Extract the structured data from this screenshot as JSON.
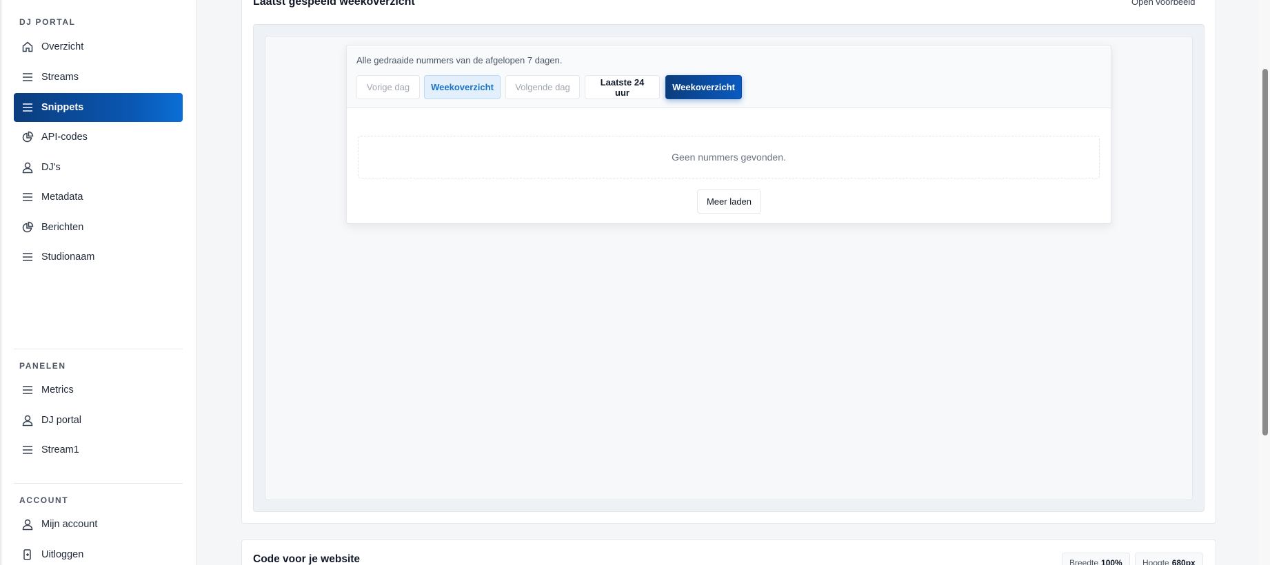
{
  "sidebar": {
    "section_portal": "DJ PORTAL",
    "portal_items": [
      {
        "label": "Overzicht",
        "icon": "home-icon"
      },
      {
        "label": "Streams",
        "icon": "list-icon"
      },
      {
        "label": "Snippets",
        "icon": "list-icon",
        "active": true
      },
      {
        "label": "API-codes",
        "icon": "pie-chart-icon"
      },
      {
        "label": "DJ's",
        "icon": "user-icon"
      },
      {
        "label": "Metadata",
        "icon": "list-icon"
      },
      {
        "label": "Berichten",
        "icon": "pie-chart-icon"
      },
      {
        "label": "Studionaam",
        "icon": "list-icon"
      }
    ],
    "section_panels": "PANELEN",
    "panel_items": [
      {
        "label": "Metrics",
        "icon": "list-icon"
      },
      {
        "label": "DJ portal",
        "icon": "user-icon"
      },
      {
        "label": "Stream1",
        "icon": "list-icon"
      }
    ],
    "section_account": "ACCOUNT",
    "account_items": [
      {
        "label": "Mijn account",
        "icon": "user-icon"
      },
      {
        "label": "Uitloggen",
        "icon": "logout-icon"
      }
    ]
  },
  "preview_card": {
    "title": "Laatst gespeeld weekoverzicht",
    "open_preview": "Open voorbeeld"
  },
  "widget": {
    "description": "Alle gedraaide nummers van de afgelopen 7 dagen.",
    "buttons": {
      "prev_day": "Vorige dag",
      "week_light": "Weekoverzicht",
      "next_day": "Volgende dag",
      "last_24h": "Laatste 24 uur",
      "week_primary": "Weekoverzicht"
    },
    "empty_text": "Geen nummers gevonden.",
    "load_more": "Meer laden"
  },
  "code_card": {
    "title": "Code voor je website",
    "width_label": "Breedte",
    "width_value": "100%",
    "height_label": "Hoogte",
    "height_value": "680px"
  },
  "colors": {
    "accent_dark": "#0b3d7d",
    "accent": "#0a5ac0",
    "accent_light_bg": "#e3f0fc"
  }
}
